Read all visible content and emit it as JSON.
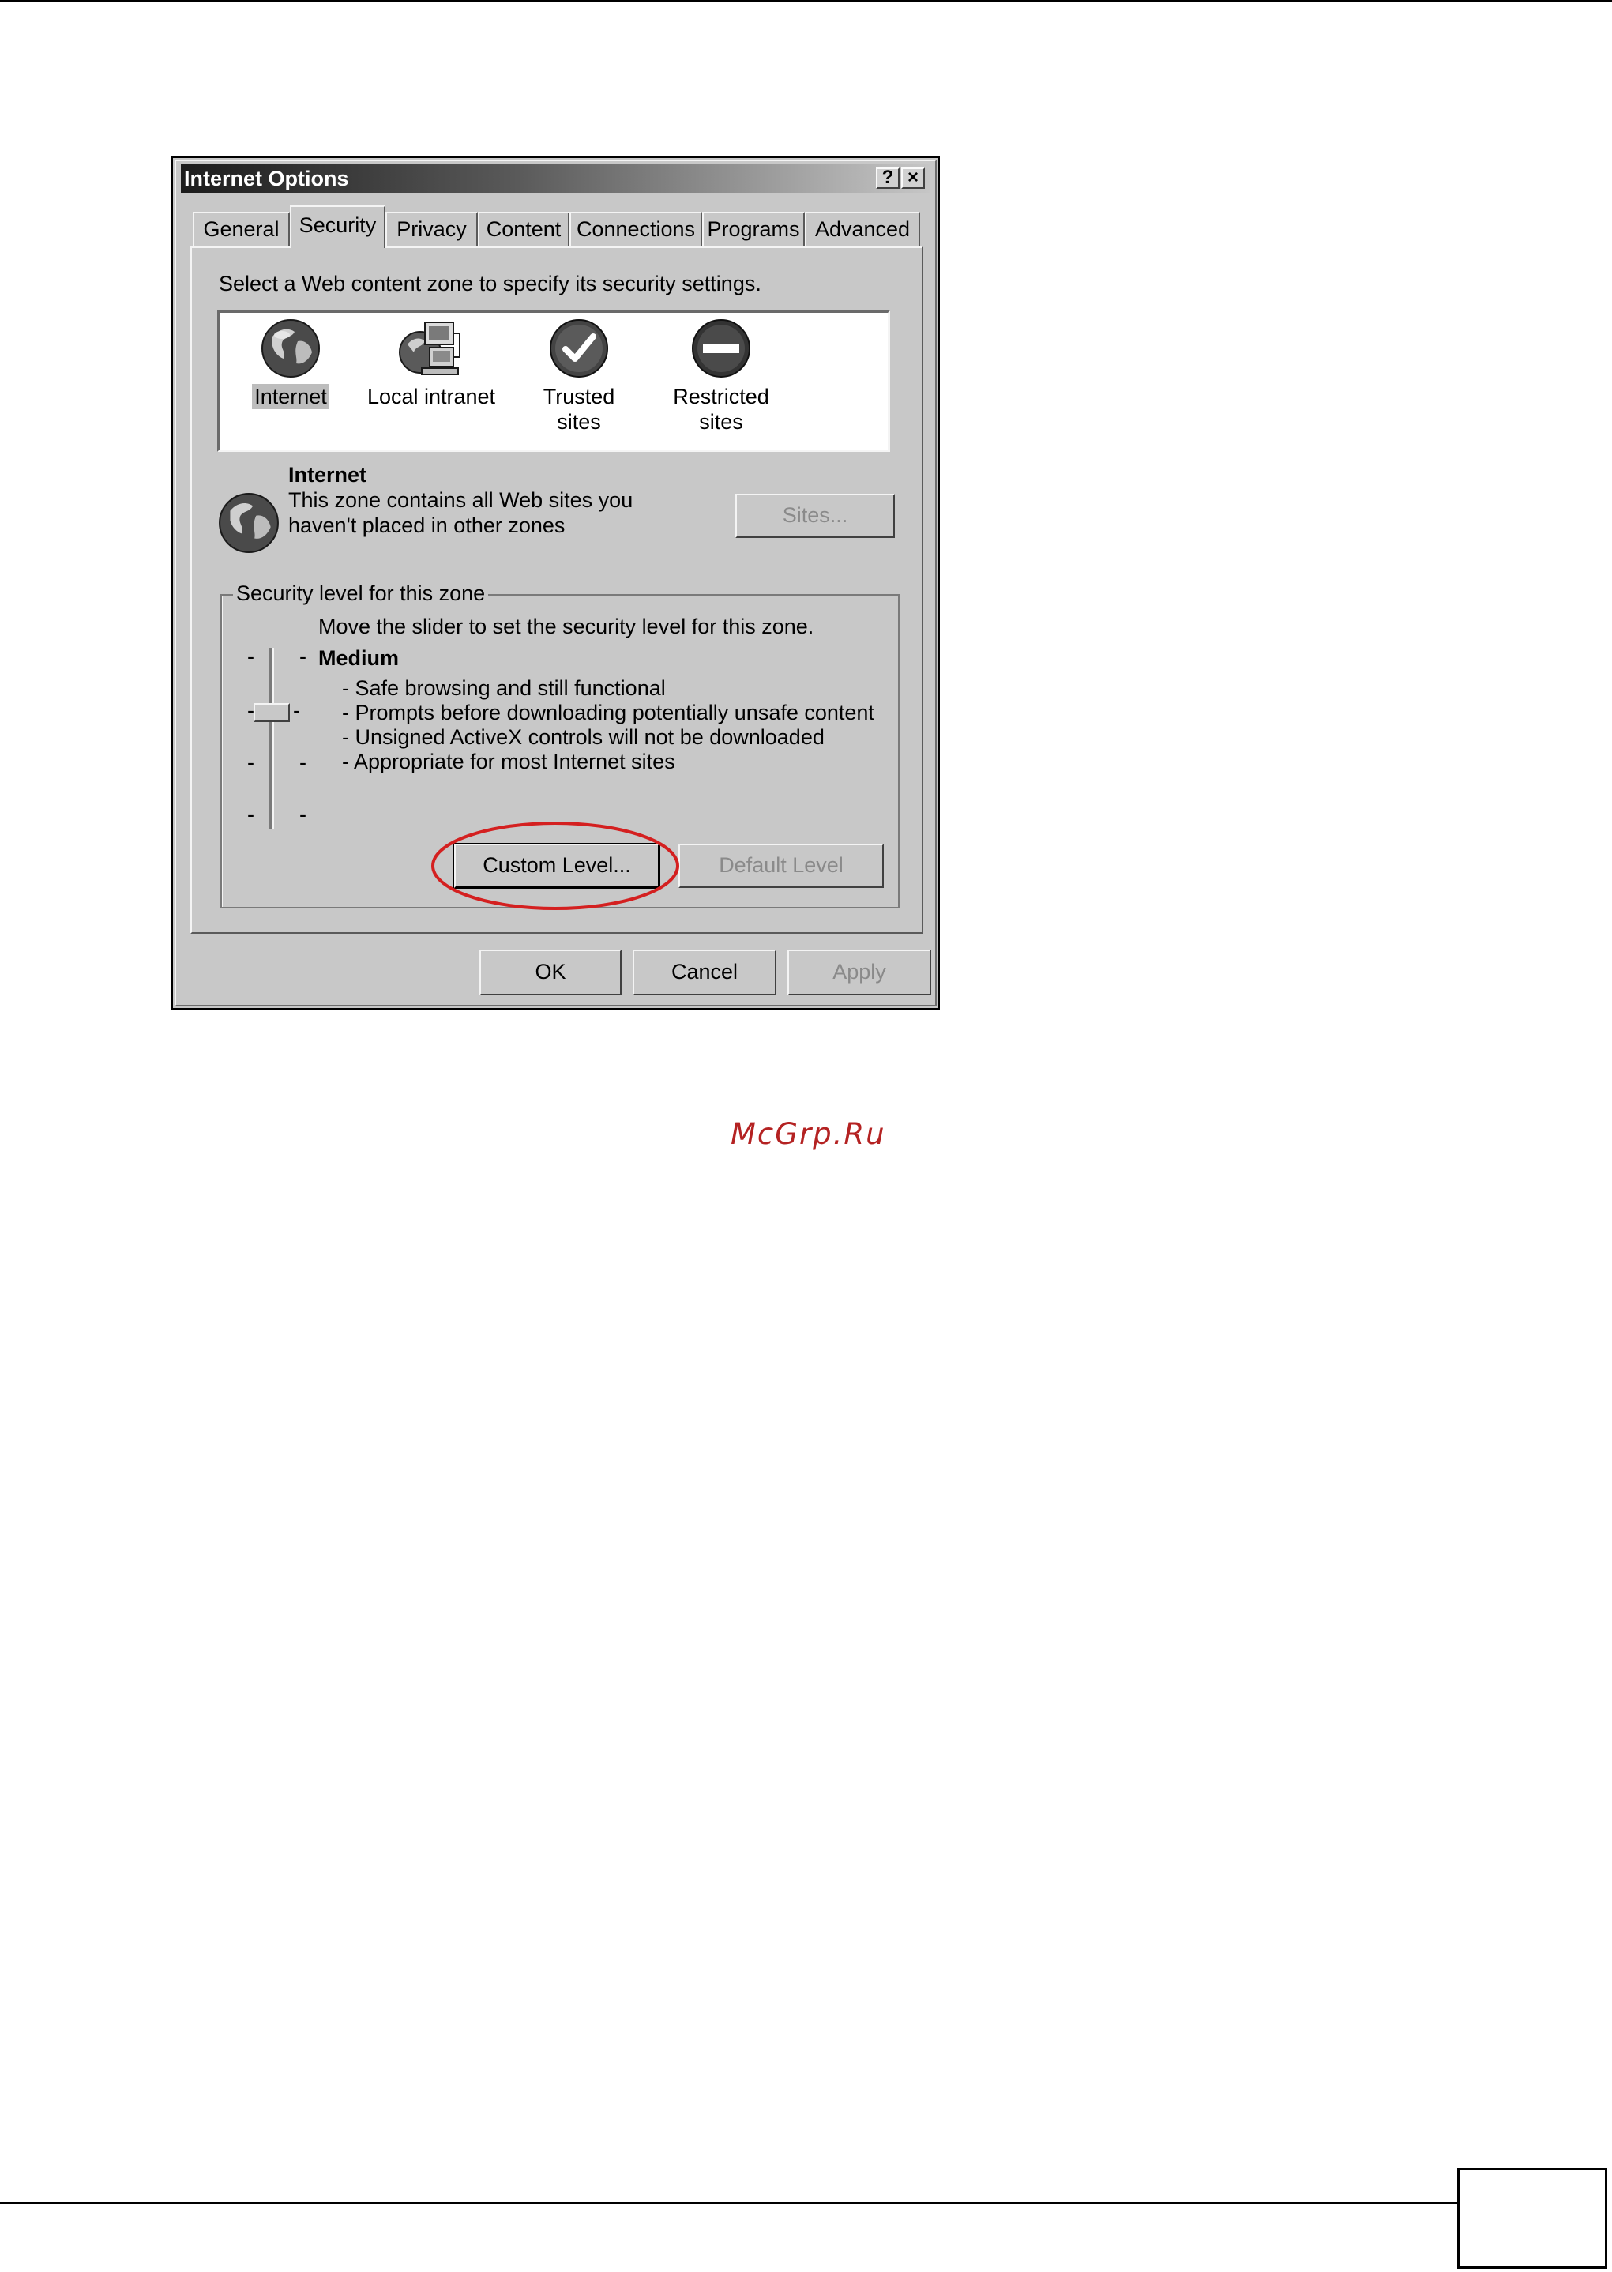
{
  "dialog": {
    "title": "Internet Options",
    "help_glyph": "?",
    "close_glyph": "×",
    "tabs": [
      "General",
      "Security",
      "Privacy",
      "Content",
      "Connections",
      "Programs",
      "Advanced"
    ],
    "active_tab": "Security",
    "instruction": "Select a Web content zone to specify its security settings.",
    "zones": [
      {
        "label": "Internet",
        "icon": "globe-icon",
        "selected": true
      },
      {
        "label": "Local intranet",
        "icon": "network-computer-icon",
        "selected": false
      },
      {
        "label": "Trusted sites",
        "icon": "checkmark-icon",
        "selected": false
      },
      {
        "label": "Restricted sites",
        "label_line1": "Restricted",
        "label_line2": "sites",
        "icon": "no-entry-icon",
        "selected": false
      }
    ],
    "zone_info": {
      "title": "Internet",
      "desc_line1": "This zone contains all Web sites you",
      "desc_line2": "haven't placed in other zones",
      "sites_button": "Sites..."
    },
    "security_level": {
      "group_label": "Security level for this zone",
      "instruction": "Move the slider to set the security level for this zone.",
      "level_name": "Medium",
      "bullets": [
        "- Safe browsing and still functional",
        "- Prompts before downloading potentially unsafe content",
        "- Unsigned ActiveX controls will not be downloaded",
        "- Appropriate for most Internet sites"
      ],
      "tick_glyph": "-",
      "custom_level_button": "Custom Level...",
      "default_level_button": "Default Level"
    },
    "buttons": {
      "ok": "OK",
      "cancel": "Cancel",
      "apply": "Apply"
    }
  },
  "watermark": "McGrp.Ru",
  "colors": {
    "highlight_ellipse": "#d42020",
    "watermark": "#b42222",
    "titlebar_dark": "#1c1c1c",
    "dialog_face": "#c8c8c8"
  }
}
